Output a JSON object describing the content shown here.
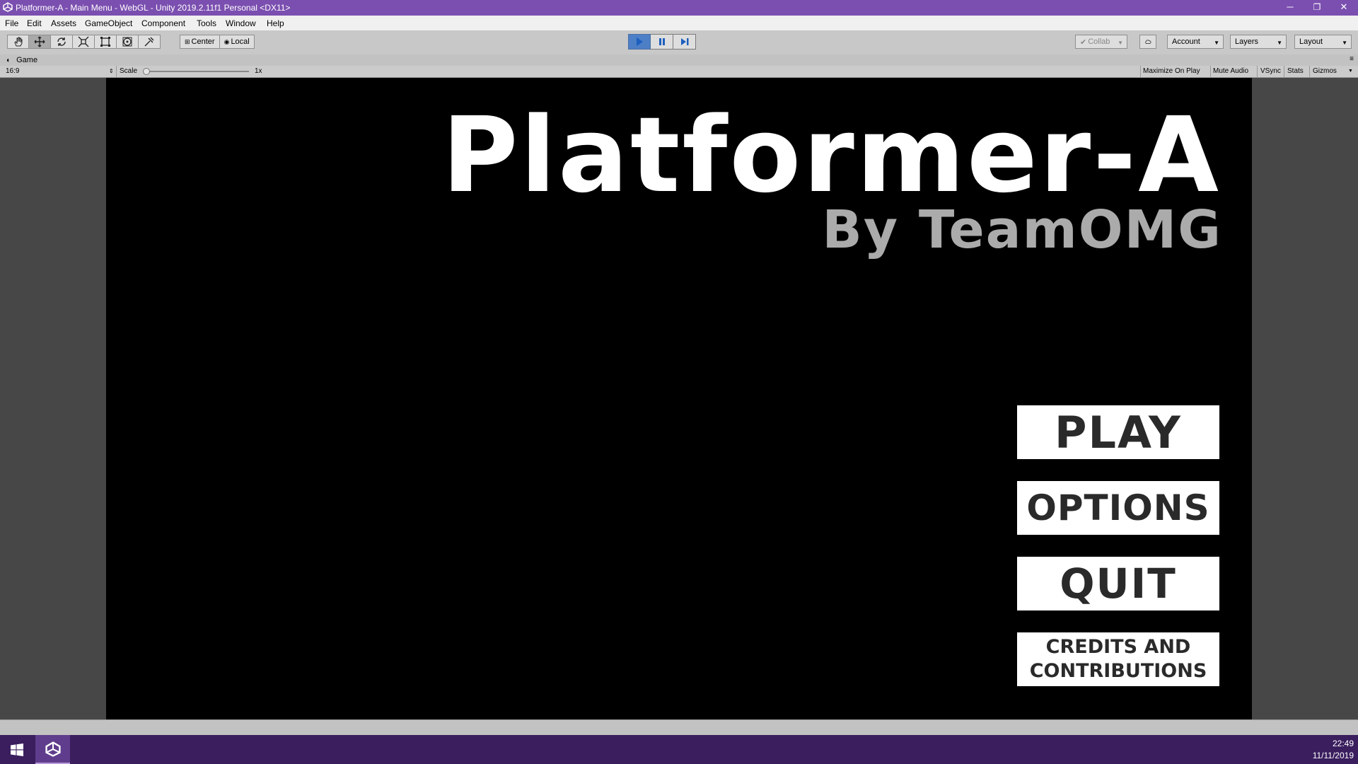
{
  "window": {
    "title": "Platformer-A - Main Menu - WebGL - Unity 2019.2.11f1 Personal <DX11>",
    "controls": {
      "minimize": "─",
      "restore": "❐",
      "close": "✕"
    }
  },
  "menu": [
    "File",
    "Edit",
    "Assets",
    "GameObject",
    "Component",
    "Tools",
    "Window",
    "Help"
  ],
  "toolbar": {
    "tools": [
      "hand-icon",
      "move-icon",
      "rotate-icon",
      "scale-icon",
      "rect-icon",
      "transform-icon",
      "custom-tool-icon"
    ],
    "active_tool": 1,
    "pivot": "Center",
    "space": "Local",
    "play_state": "playing",
    "collab": "Collab",
    "account": "Account",
    "layers": "Layers",
    "layout": "Layout"
  },
  "game_panel": {
    "tab": "Game",
    "aspect": "16:9",
    "scale_label": "Scale",
    "scale_value": "1x",
    "scale_level": 0,
    "options": [
      "Maximize On Play",
      "Mute Audio",
      "VSync",
      "Stats",
      "Gizmos"
    ]
  },
  "game": {
    "title": "Platformer-A",
    "subtitle": "By TeamOMG",
    "buttons": [
      "PLAY",
      "OPTIONS",
      "QUIT",
      "CREDITS AND CONTRIBUTIONS"
    ]
  },
  "taskbar": {
    "time": "22:49",
    "date": "11/11/2019"
  },
  "colors": {
    "titlebar": "#7b4fb0",
    "taskbar": "#3a1e5e",
    "play_active": "#4d7fc7",
    "game_bg": "#000000",
    "subtitle": "#ababab"
  }
}
